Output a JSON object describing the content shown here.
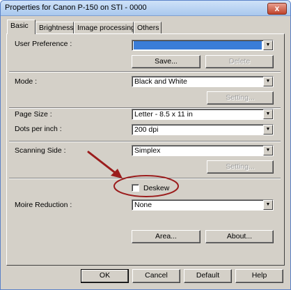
{
  "window": {
    "title": "Properties for Canon P-150 on STI - 0000",
    "close_glyph": "x"
  },
  "tabs": [
    {
      "label": "Basic",
      "active": true
    },
    {
      "label": "Brightness",
      "active": false
    },
    {
      "label": "Image processing",
      "active": false
    },
    {
      "label": "Others",
      "active": false
    }
  ],
  "user_preference": {
    "label": "User Preference :",
    "value": "",
    "save_label": "Save...",
    "delete_label": "Delete"
  },
  "mode": {
    "label": "Mode :",
    "value": "Black and White",
    "setting_label": "Setting..."
  },
  "page_size": {
    "label": "Page Size :",
    "value": "Letter - 8.5 x 11 in"
  },
  "dots_per_inch": {
    "label": "Dots per inch :",
    "value": "200 dpi"
  },
  "scanning_side": {
    "label": "Scanning Side :",
    "value": "Simplex",
    "setting_label": "Setting..."
  },
  "deskew": {
    "label": "Deskew",
    "checked": false
  },
  "moire_reduction": {
    "label": "Moire Reduction :",
    "value": "None"
  },
  "panel_buttons": {
    "area_label": "Area...",
    "about_label": "About..."
  },
  "footer": {
    "ok_label": "OK",
    "cancel_label": "Cancel",
    "default_label": "Default",
    "help_label": "Help"
  },
  "colors": {
    "annotation": "#9b1c1c",
    "selection": "#3a7dd8"
  }
}
